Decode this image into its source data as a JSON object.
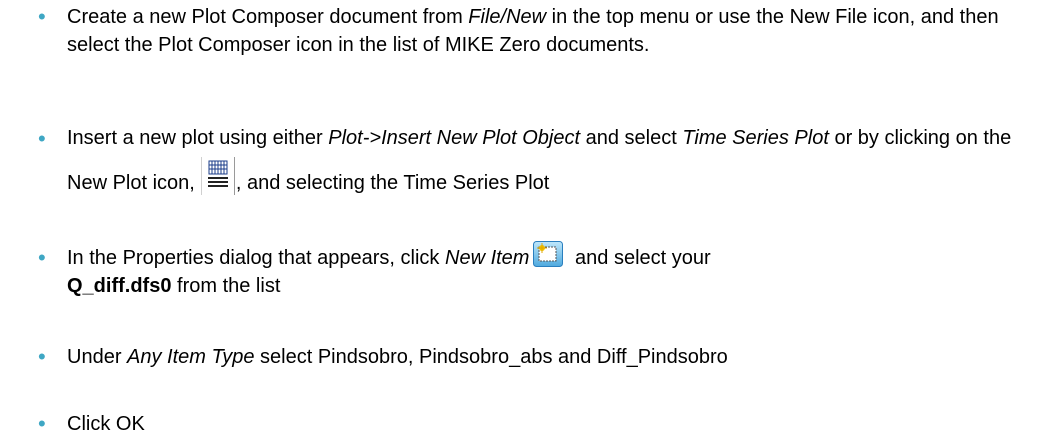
{
  "bullets": [
    {
      "seg1": "Create a new Plot Composer document from ",
      "seg2_italic": "File/New",
      "seg3": " in the top menu or use the New File icon, and then select the Plot Composer icon in the list of MIKE Zero documents."
    },
    {
      "seg1": "Insert a new plot using either ",
      "seg2_italic": "Plot->Insert New Plot Object",
      "seg3": " and select ",
      "seg4_italic": "Time Series Plot",
      "seg5": " or by clicking on the New Plot icon,",
      "seg6": ", and selecting the Time Series Plot"
    },
    {
      "seg1": "In the Properties dialog that appears, click ",
      "seg2_italic": "New Item",
      "seg3": " and select your ",
      "seg4_bold": "Q_diff.dfs0",
      "seg5": " from the list"
    },
    {
      "seg1": "Under ",
      "seg2_italic": "Any Item Type",
      "seg3": " select Pindsobro, Pindsobro_abs and Diff_Pindsobro"
    },
    {
      "seg1": "Click OK"
    }
  ],
  "bullet_char": "•",
  "icons": {
    "new_plot": "new-plot-icon",
    "new_item": "new-item-icon"
  },
  "colors": {
    "bullet": "#3fa7c4",
    "text": "#000000"
  }
}
